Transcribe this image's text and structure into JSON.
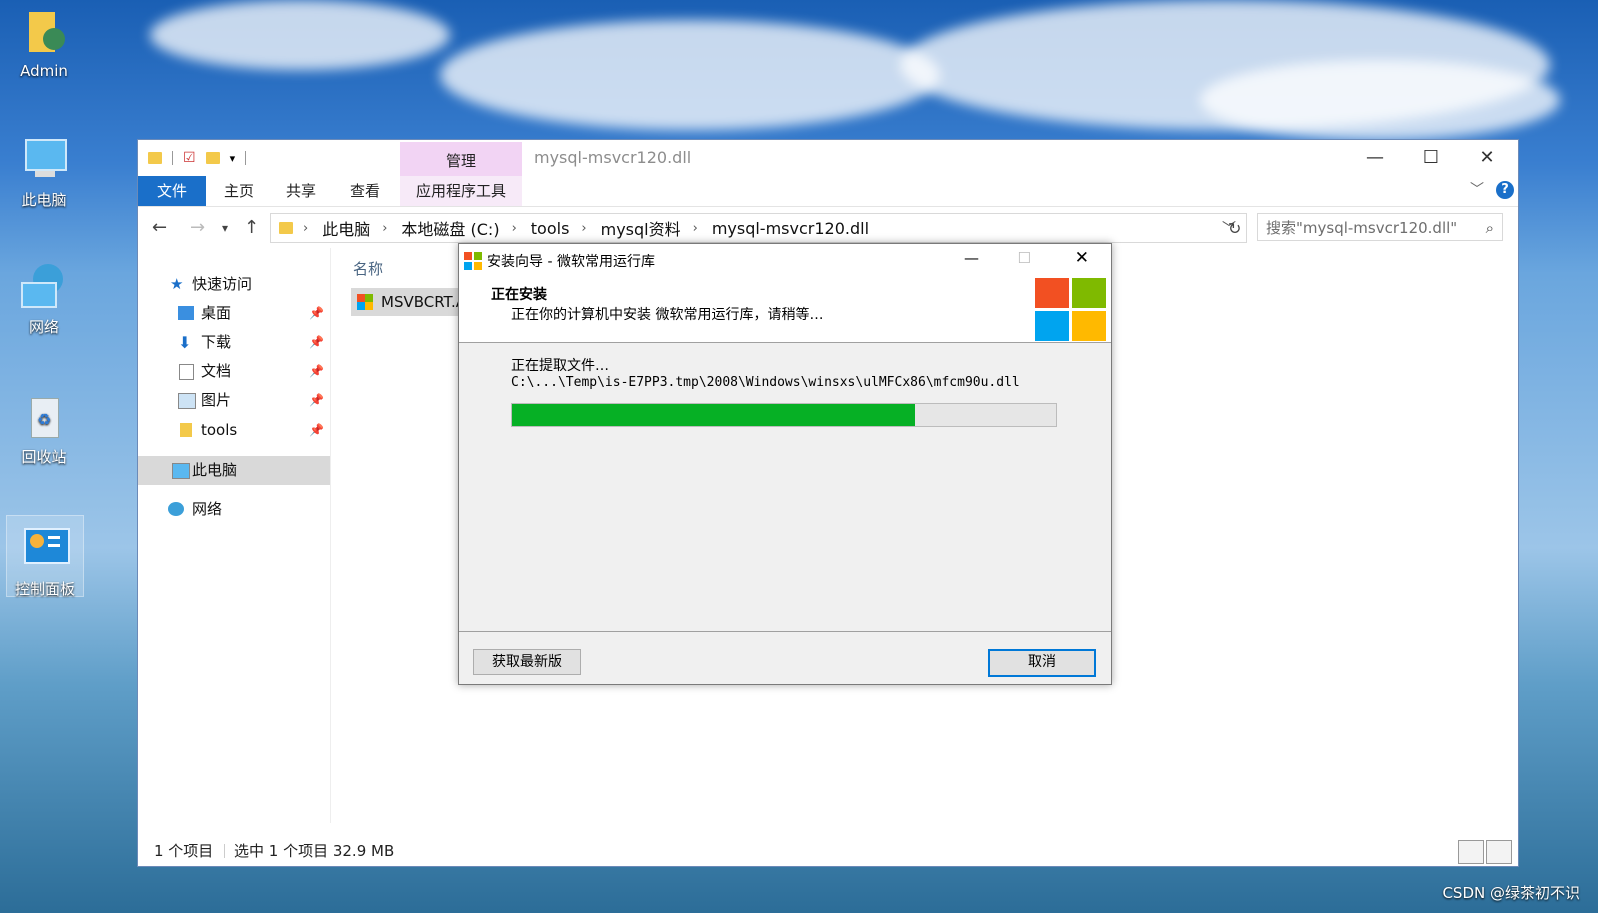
{
  "desktop": {
    "icons": [
      {
        "label": "Admin"
      },
      {
        "label": "此电脑"
      },
      {
        "label": "网络"
      },
      {
        "label": "回收站"
      },
      {
        "label": "控制面板"
      }
    ]
  },
  "explorer": {
    "title": "mysql-msvcr120.dll",
    "contextual_tab_group": "管理",
    "ribbon_tabs": [
      "文件",
      "主页",
      "共享",
      "查看",
      "应用程序工具"
    ],
    "breadcrumb": [
      "此电脑",
      "本地磁盘 (C:)",
      "tools",
      "mysql资料",
      "mysql-msvcr120.dll"
    ],
    "search_placeholder": "搜索\"mysql-msvcr120.dll\"",
    "sidebar": {
      "quick_access": "快速访问",
      "items": [
        "桌面",
        "下载",
        "文档",
        "图片",
        "tools"
      ],
      "this_pc": "此电脑",
      "network": "网络"
    },
    "column_name": "名称",
    "file_name": "MSVBCRT.A",
    "status": {
      "count": "1 个项目",
      "selected": "选中 1 个项目  32.9 MB"
    }
  },
  "installer": {
    "title": "安装向导 - 微软常用运行库",
    "heading": "正在安装",
    "subheading": "正在你的计算机中安装 微软常用运行库，请稍等…",
    "status": "正在提取文件…",
    "path": "C:\\...\\Temp\\is-E7PP3.tmp\\2008\\Windows\\winsxs\\ulMFCx86\\mfcm90u.dll",
    "progress": 0.74,
    "buttons": {
      "update": "获取最新版",
      "cancel": "取消"
    },
    "colors": {
      "red": "#f25022",
      "green": "#7fba00",
      "blue": "#00a4ef",
      "yellow": "#ffb900",
      "progress": "#06b025"
    }
  },
  "watermark": "CSDN @绿茶初不识"
}
